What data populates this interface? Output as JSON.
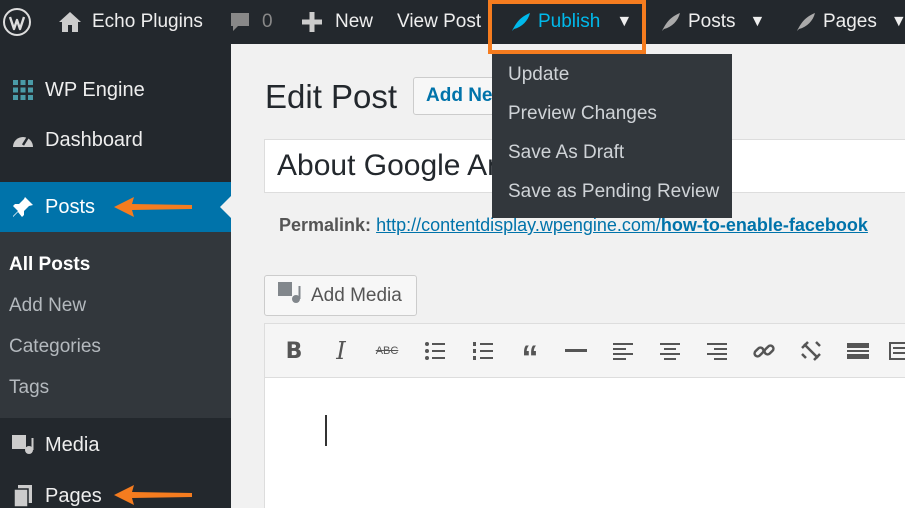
{
  "adminbar": {
    "site_name": "Echo Plugins",
    "comments_count": "0",
    "new_label": "New",
    "view_post_label": "View Post",
    "publish_label": "Publish",
    "posts_label": "Posts",
    "pages_label": "Pages"
  },
  "publish_menu": {
    "items": [
      "Update",
      "Preview Changes",
      "Save As Draft",
      "Save as Pending Review"
    ]
  },
  "sidebar": {
    "items": [
      {
        "label": "WP Engine",
        "icon": "grid-icon"
      },
      {
        "label": "Dashboard",
        "icon": "dashboard-icon"
      },
      {
        "label": "Posts",
        "icon": "pin-icon",
        "active": true
      },
      {
        "label": "Media",
        "icon": "media-icon"
      },
      {
        "label": "Pages",
        "icon": "pages-icon"
      }
    ],
    "submenu": [
      "All Posts",
      "Add New",
      "Categories",
      "Tags"
    ]
  },
  "editor": {
    "heading": "Edit Post",
    "add_new_label": "Add New",
    "post_title": "About Google Analytics",
    "permalink_label": "Permalink:",
    "permalink_base": "http://contentdisplay.wpengine.com/",
    "permalink_slug": "how-to-enable-facebook",
    "add_media_label": "Add Media",
    "toolbar_icons": [
      "bold-icon",
      "italic-icon",
      "strikethrough-icon",
      "bullet-list-icon",
      "numbered-list-icon",
      "blockquote-icon",
      "horizontal-line-icon",
      "align-left-icon",
      "align-center-icon",
      "align-right-icon",
      "link-icon",
      "unlink-icon",
      "read-more-icon",
      "toolbar-toggle-icon"
    ]
  },
  "colors": {
    "accent": "#0073aa",
    "highlight": "#f57c1f",
    "publish": "#00b9eb",
    "adminbar": "#23282d"
  }
}
